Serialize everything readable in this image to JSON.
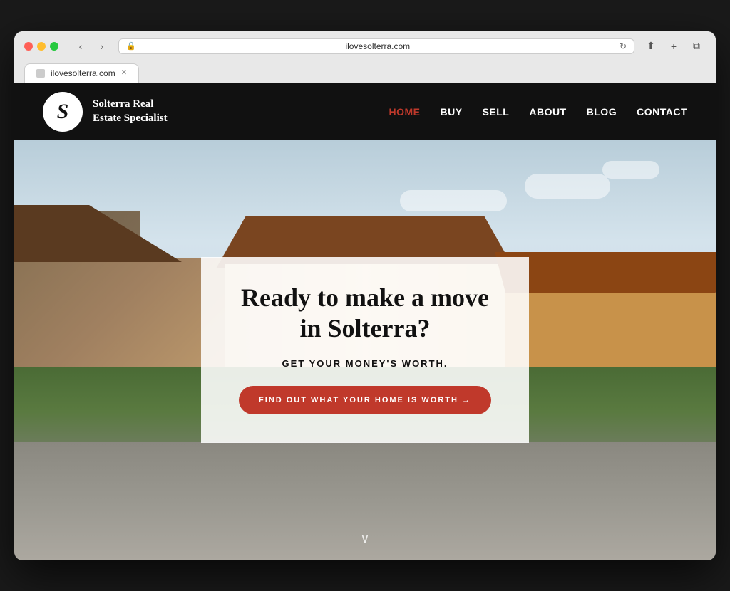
{
  "browser": {
    "url": "ilovesolterra.com",
    "tab_label": "ilovesolterra.com"
  },
  "site": {
    "logo": {
      "letter": "S",
      "name_line1": "Solterra Real",
      "name_line2": "Estate Specialist"
    },
    "nav": {
      "items": [
        {
          "label": "HOME",
          "active": true
        },
        {
          "label": "BUY",
          "active": false
        },
        {
          "label": "SELL",
          "active": false
        },
        {
          "label": "ABOUT",
          "active": false
        },
        {
          "label": "BLOG",
          "active": false
        },
        {
          "label": "CONTACT",
          "active": false
        }
      ]
    },
    "hero": {
      "headline": "Ready to make a move in Solterra?",
      "subheadline": "GET YOUR MONEY'S WORTH.",
      "cta_label": "FIND OUT WHAT YOUR HOME IS WORTH →"
    },
    "scroll_indicator": "∨"
  }
}
